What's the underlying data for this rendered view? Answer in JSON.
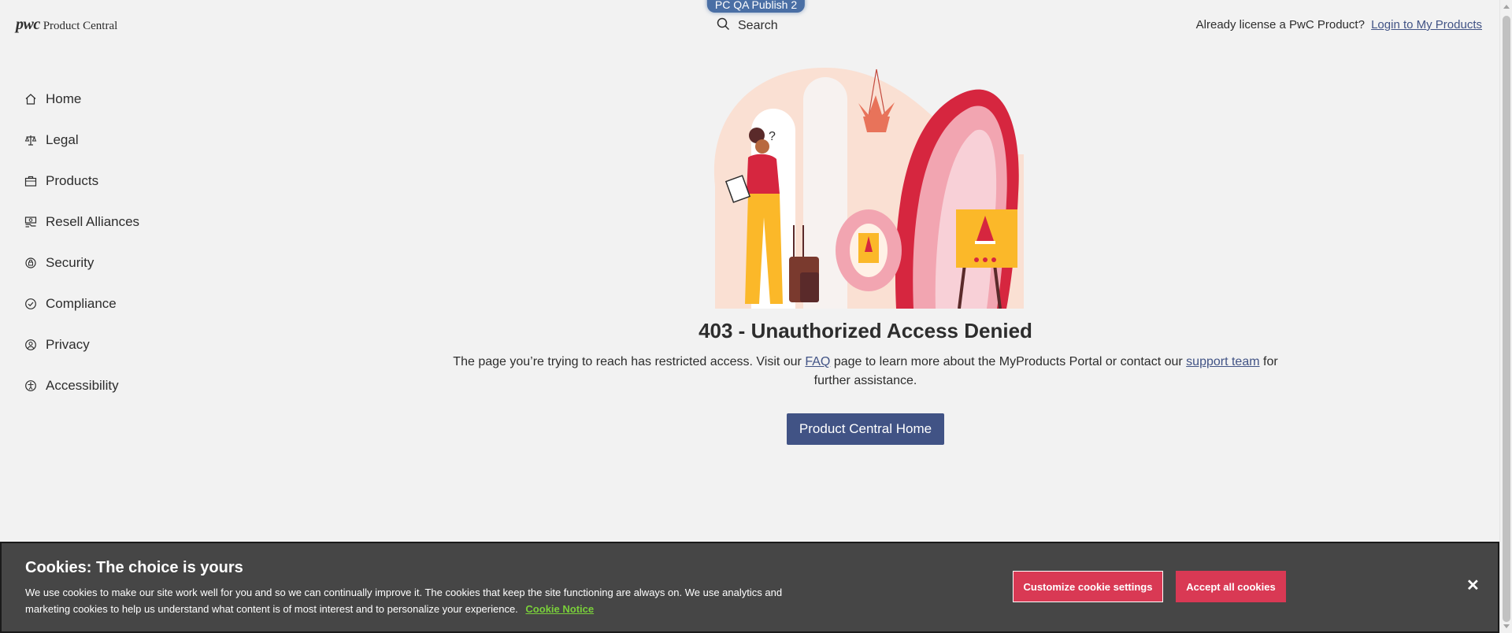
{
  "env_badge": "PC QA Publish 2",
  "header": {
    "logo_mark": "pwc",
    "logo_text": "Product Central",
    "search_label": "Search",
    "already_text": "Already license a PwC Product?",
    "login_link": "Login to My Products"
  },
  "sidebar": {
    "items": [
      {
        "label": "Home",
        "icon": "home-icon"
      },
      {
        "label": "Legal",
        "icon": "scales-icon"
      },
      {
        "label": "Products",
        "icon": "briefcase-icon"
      },
      {
        "label": "Resell Alliances",
        "icon": "handshake-icon"
      },
      {
        "label": "Security",
        "icon": "shield-icon"
      },
      {
        "label": "Compliance",
        "icon": "check-circle-icon"
      },
      {
        "label": "Privacy",
        "icon": "user-privacy-icon"
      },
      {
        "label": "Accessibility",
        "icon": "accessibility-icon"
      }
    ]
  },
  "error": {
    "title": "403 - Unauthorized Access Denied",
    "text_before": "The page you’re trying to reach has restricted access. Visit our",
    "faq_link": "FAQ",
    "text_middle": "page to learn more about the MyProducts Portal or contact our",
    "support_link": "support team",
    "text_after": "for further assistance.",
    "button_label": "Product Central Home"
  },
  "cookie": {
    "title": "Cookies: The choice is yours",
    "text": "We use cookies to make our site work well for you and so we can continually improve it. The cookies that keep the site functioning are always on. We use analytics and marketing cookies to help us understand what content is of most interest and to personalize your experience.",
    "notice_link": "Cookie Notice",
    "customize_label": "Customize cookie settings",
    "accept_label": "Accept all cookies",
    "close_label": "✕"
  },
  "colors": {
    "accent": "#415385",
    "cookie_bg": "#464646",
    "cookie_button": "#d93954",
    "cookie_link": "#7ad03a"
  }
}
